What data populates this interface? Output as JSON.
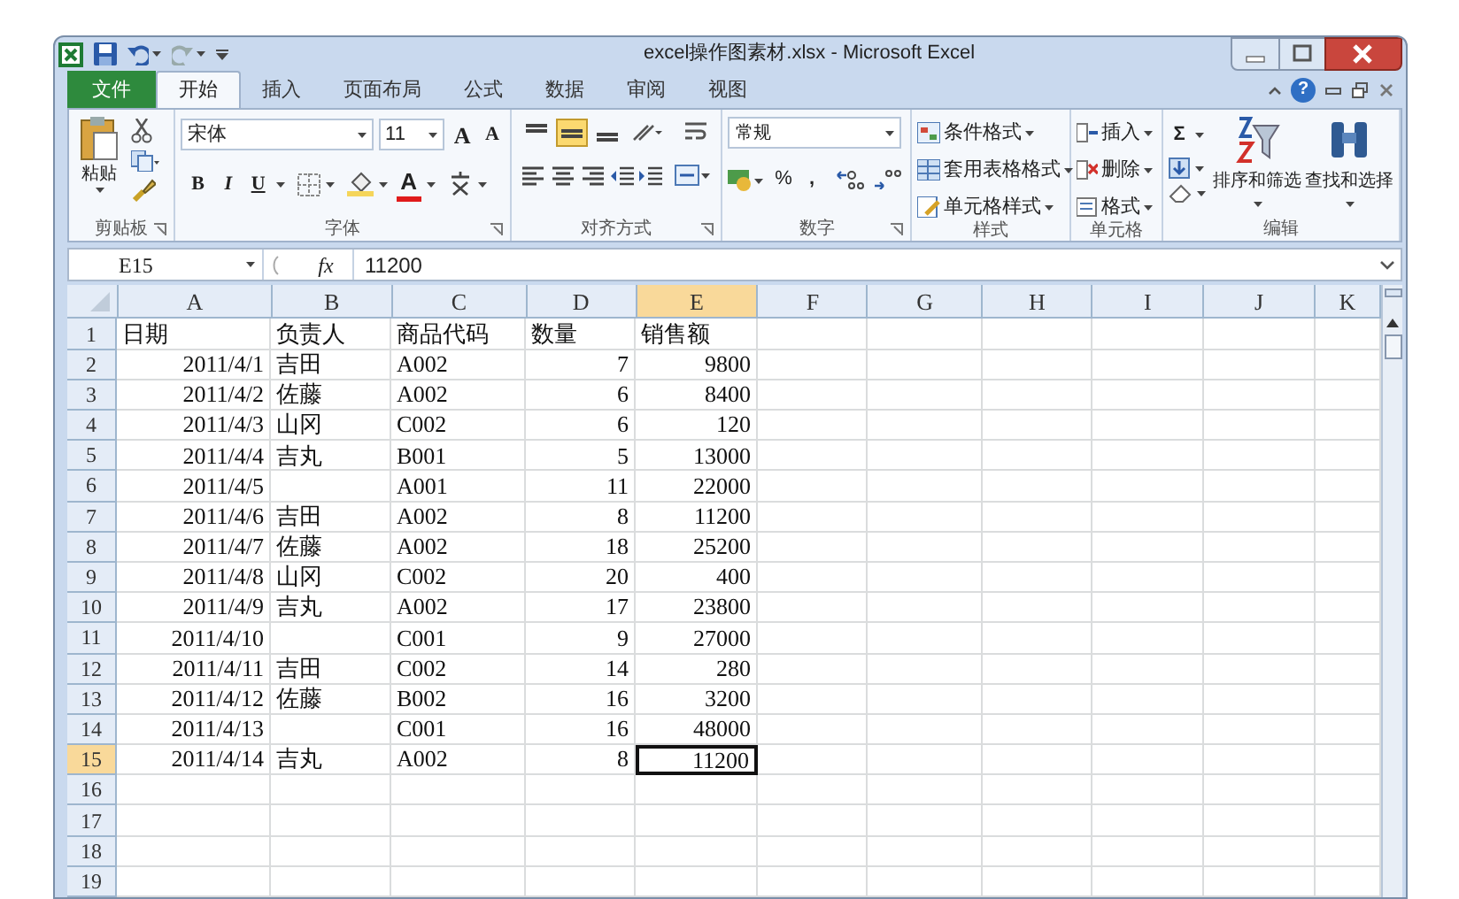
{
  "window": {
    "title": "excel操作图素材.xlsx - Microsoft Excel",
    "help": "?"
  },
  "tabs": [
    {
      "label": "文件",
      "kind": "file",
      "selected": false
    },
    {
      "label": "开始",
      "kind": "normal",
      "selected": true
    },
    {
      "label": "插入",
      "kind": "normal",
      "selected": false
    },
    {
      "label": "页面布局",
      "kind": "normal",
      "selected": false
    },
    {
      "label": "公式",
      "kind": "normal",
      "selected": false
    },
    {
      "label": "数据",
      "kind": "normal",
      "selected": false
    },
    {
      "label": "审阅",
      "kind": "normal",
      "selected": false
    },
    {
      "label": "视图",
      "kind": "normal",
      "selected": false
    }
  ],
  "ribbon": {
    "clipboard": {
      "paste": "粘贴",
      "label": "剪贴板"
    },
    "font": {
      "font_name": "宋体",
      "font_size": "11",
      "grow": "A",
      "shrink": "A",
      "bold": "B",
      "italic": "I",
      "underline": "U",
      "font_color": "A",
      "label": "字体"
    },
    "alignment": {
      "vertical_align": [
        {
          "selected": false
        },
        {
          "selected": true
        },
        {
          "selected": false
        }
      ],
      "label": "对齐方式"
    },
    "number": {
      "format": "常规",
      "percent": "%",
      "comma": ",",
      "label": "数字"
    },
    "styles": {
      "items": [
        "条件格式",
        "套用表格格式",
        "单元格样式"
      ],
      "label": "样式"
    },
    "cells": {
      "items": [
        "插入",
        "删除",
        "格式"
      ],
      "label": "单元格"
    },
    "editing": {
      "sum": "Σ",
      "sort_filter": "排序和筛选",
      "find_select": "查找和选择",
      "label": "编辑"
    }
  },
  "formula_bar": {
    "name_box": "E15",
    "fx": "fx",
    "value": "11200"
  },
  "sheet": {
    "columns": [
      {
        "label": "A",
        "kind": "date",
        "selected": false
      },
      {
        "label": "B",
        "kind": "text",
        "selected": false
      },
      {
        "label": "C",
        "kind": "text",
        "selected": false
      },
      {
        "label": "D",
        "kind": "number",
        "selected": false
      },
      {
        "label": "E",
        "kind": "number",
        "selected": true
      },
      {
        "label": "F",
        "kind": "text",
        "selected": false
      },
      {
        "label": "G",
        "kind": "text",
        "selected": false
      },
      {
        "label": "H",
        "kind": "text",
        "selected": false
      },
      {
        "label": "I",
        "kind": "text",
        "selected": false
      },
      {
        "label": "J",
        "kind": "text",
        "selected": false
      },
      {
        "label": "K",
        "kind": "text",
        "selected": false
      }
    ],
    "rows": [
      {
        "number": "1",
        "kind": "header",
        "selected": false,
        "date": "日期",
        "owner": "负责人",
        "code": "商品代码",
        "qty": "数量",
        "sales": "销售额"
      },
      {
        "number": "2",
        "kind": "data",
        "selected": false,
        "date": "2011/4/1",
        "owner": "吉田",
        "code": "A002",
        "qty": "7",
        "sales": "9800"
      },
      {
        "number": "3",
        "kind": "data",
        "selected": false,
        "date": "2011/4/2",
        "owner": "佐藤",
        "code": "A002",
        "qty": "6",
        "sales": "8400"
      },
      {
        "number": "4",
        "kind": "data",
        "selected": false,
        "date": "2011/4/3",
        "owner": "山冈",
        "code": "C002",
        "qty": "6",
        "sales": "120"
      },
      {
        "number": "5",
        "kind": "data",
        "selected": false,
        "date": "2011/4/4",
        "owner": "吉丸",
        "code": "B001",
        "qty": "5",
        "sales": "13000"
      },
      {
        "number": "6",
        "kind": "data",
        "selected": false,
        "date": "2011/4/5",
        "code": "A001",
        "qty": "11",
        "sales": "22000"
      },
      {
        "number": "7",
        "kind": "data",
        "selected": false,
        "date": "2011/4/6",
        "owner": "吉田",
        "code": "A002",
        "qty": "8",
        "sales": "11200"
      },
      {
        "number": "8",
        "kind": "data",
        "selected": false,
        "date": "2011/4/7",
        "owner": "佐藤",
        "code": "A002",
        "qty": "18",
        "sales": "25200"
      },
      {
        "number": "9",
        "kind": "data",
        "selected": false,
        "date": "2011/4/8",
        "owner": "山冈",
        "code": "C002",
        "qty": "20",
        "sales": "400"
      },
      {
        "number": "10",
        "kind": "data",
        "selected": false,
        "date": "2011/4/9",
        "owner": "吉丸",
        "code": "A002",
        "qty": "17",
        "sales": "23800"
      },
      {
        "number": "11",
        "kind": "data",
        "selected": false,
        "date": "2011/4/10",
        "code": "C001",
        "qty": "9",
        "sales": "27000"
      },
      {
        "number": "12",
        "kind": "data",
        "selected": false,
        "date": "2011/4/11",
        "owner": "吉田",
        "code": "C002",
        "qty": "14",
        "sales": "280"
      },
      {
        "number": "13",
        "kind": "data",
        "selected": false,
        "date": "2011/4/12",
        "owner": "佐藤",
        "code": "B002",
        "qty": "16",
        "sales": "3200"
      },
      {
        "number": "14",
        "kind": "data",
        "selected": false,
        "date": "2011/4/13",
        "code": "C001",
        "qty": "16",
        "sales": "48000"
      },
      {
        "number": "15",
        "kind": "data",
        "selected": true,
        "date": "2011/4/14",
        "owner": "吉丸",
        "code": "A002",
        "qty": "8",
        "sales": "11200"
      },
      {
        "number": "16",
        "kind": "data",
        "selected": false
      },
      {
        "number": "17",
        "kind": "data",
        "selected": false
      },
      {
        "number": "18",
        "kind": "data",
        "selected": false
      },
      {
        "number": "19",
        "kind": "data",
        "selected": false
      }
    ]
  }
}
